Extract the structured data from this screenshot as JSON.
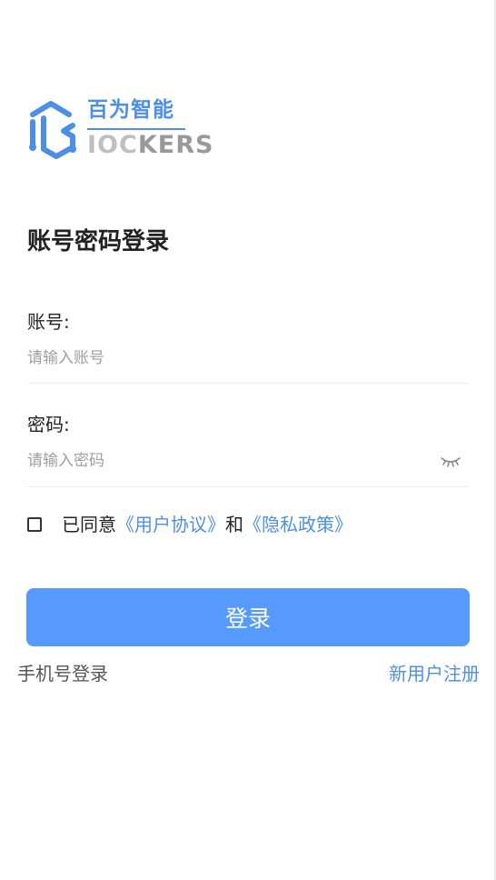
{
  "brand": {
    "name_cn": "百为智能",
    "name_en_prefix": "IOC",
    "name_en_suffix": "KERS",
    "primary_color": "#4d8fe8"
  },
  "page": {
    "title": "账号密码登录"
  },
  "form": {
    "account": {
      "label": "账号:",
      "placeholder": "请输入账号",
      "value": ""
    },
    "password": {
      "label": "密码:",
      "placeholder": "请输入密码",
      "value": "",
      "toggle_icon": "eye-closed-icon"
    },
    "agreement": {
      "checked": false,
      "prefix": "已同意",
      "user_agreement": "《用户协议》",
      "conjunction": "和",
      "privacy_policy": "《隐私政策》"
    },
    "submit_label": "登录",
    "submit_color": "#559afc"
  },
  "footer": {
    "phone_login": "手机号登录",
    "register": "新用户注册"
  }
}
